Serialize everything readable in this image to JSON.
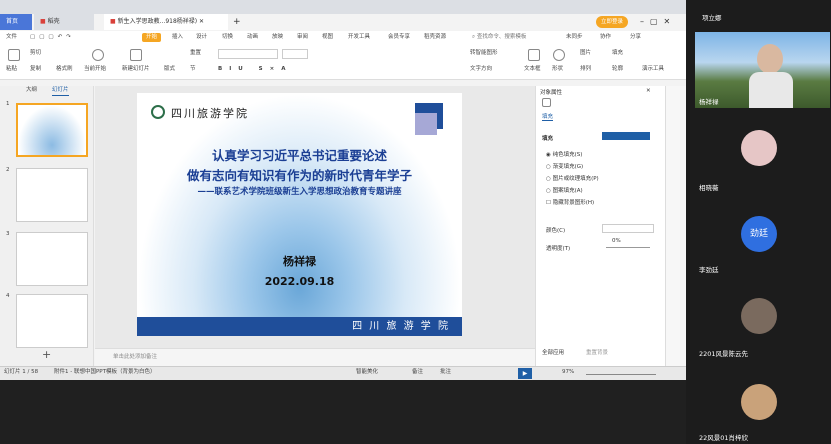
{
  "tabs": {
    "home": "首页",
    "shell": "稻壳",
    "doc": "新生入学思政教...918杨祥禄)"
  },
  "topbar": {
    "login": "立即登录"
  },
  "menu": {
    "file": "文件",
    "items": [
      "开始",
      "插入",
      "设计",
      "切换",
      "动画",
      "放映",
      "审阅",
      "视图",
      "开发工具",
      "会员专享",
      "稻壳资源"
    ],
    "search": "查找命令、搜索模板",
    "unsync": "未同步",
    "collab": "协作",
    "share": "分享"
  },
  "ribbon": {
    "cut": "剪切",
    "copy": "复制",
    "format_painter": "格式刷",
    "paste": "粘贴",
    "from_current": "当前开始",
    "new_slide": "新建幻灯片",
    "layout": "版式",
    "section": "节",
    "reset": "重置",
    "textbox": "文本框",
    "shape": "形状",
    "arrange": "排列",
    "picture": "图片",
    "fill": "填充",
    "outline": "轮廓",
    "show": "演示工具",
    "para_text": "转智能图形",
    "text_format": "文字方向"
  },
  "panel": {
    "outline": "大纲",
    "slides": "幻灯片"
  },
  "slide": {
    "school": "四川旅游学院",
    "line1": "认真学习习近平总书记重要论述",
    "line2": "做有志向有知识有作为的新时代青年学子",
    "line3": "——联系艺术学院班级新生入学思想政治教育专题讲座",
    "speaker": "杨祥禄",
    "date": "2022.09.18",
    "footer": "四 川 旅 游 学 院"
  },
  "props": {
    "title": "对象属性",
    "tab": "填充",
    "fill_label": "填充",
    "opts": [
      "纯色填充(S)",
      "渐变填充(G)",
      "图片或纹理填充(P)",
      "图案填充(A)",
      "隐藏背景图形(H)"
    ],
    "color": "颜色(C)",
    "transparency": "透明度(T)",
    "transparency_val": "0%",
    "apply_all": "全部应用",
    "reset_bg": "重置背景"
  },
  "notes": "单击此处添加备注",
  "status": {
    "page": "幻灯片 1 / 58",
    "theme": "附件1 - 联想中国PPT模板（背景为白色）",
    "beautify": "智能美化",
    "notes": "备注",
    "comment": "批注",
    "zoom": "97%"
  },
  "participants": [
    {
      "name": "项立娜"
    },
    {
      "name": "杨祥禄"
    },
    {
      "name": "相晓薇"
    },
    {
      "name": "李劲廷",
      "avatar_text": "劲廷"
    },
    {
      "name": "2201风景陈云先"
    },
    {
      "name": "22风景01肖梓欣"
    }
  ],
  "colors": {
    "accent": "#f5a623",
    "wps_red": "#d9403a",
    "fill_swatch": "#1f5fa6",
    "avatar_blue": "#2f6fe0"
  }
}
